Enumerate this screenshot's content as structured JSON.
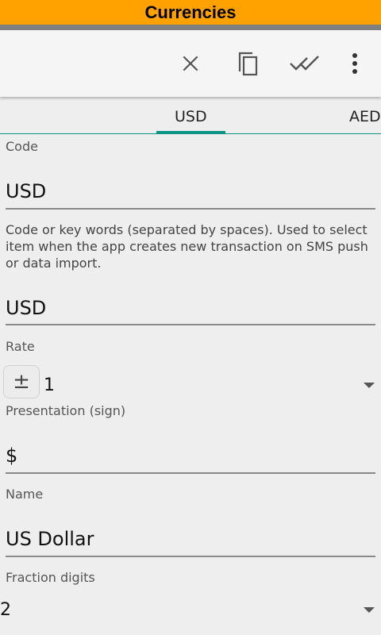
{
  "window": {
    "title": "Currencies"
  },
  "toolbar": {
    "icons": [
      "close-icon",
      "copy-icon",
      "done-all-icon",
      "more-vert-icon"
    ]
  },
  "tabs": [
    {
      "label": "USD",
      "selected": true
    },
    {
      "label": "AED",
      "selected": false
    }
  ],
  "form": {
    "code": {
      "label": "Code",
      "value": "USD"
    },
    "keywords": {
      "hint": "Code or key words (separated by spaces). Used to select item when the app creates new transaction on SMS push or data import.",
      "value": "USD"
    },
    "rate": {
      "label": "Rate",
      "sign_button": "±",
      "value": "1"
    },
    "presentation": {
      "label": "Presentation (sign)",
      "value": "$"
    },
    "name": {
      "label": "Name",
      "value": "US Dollar"
    },
    "fraction_digits": {
      "label": "Fraction digits",
      "value": "2"
    }
  },
  "colors": {
    "title_bar": "#ffa200",
    "accent": "#0b9385",
    "background": "#eeeeee"
  }
}
